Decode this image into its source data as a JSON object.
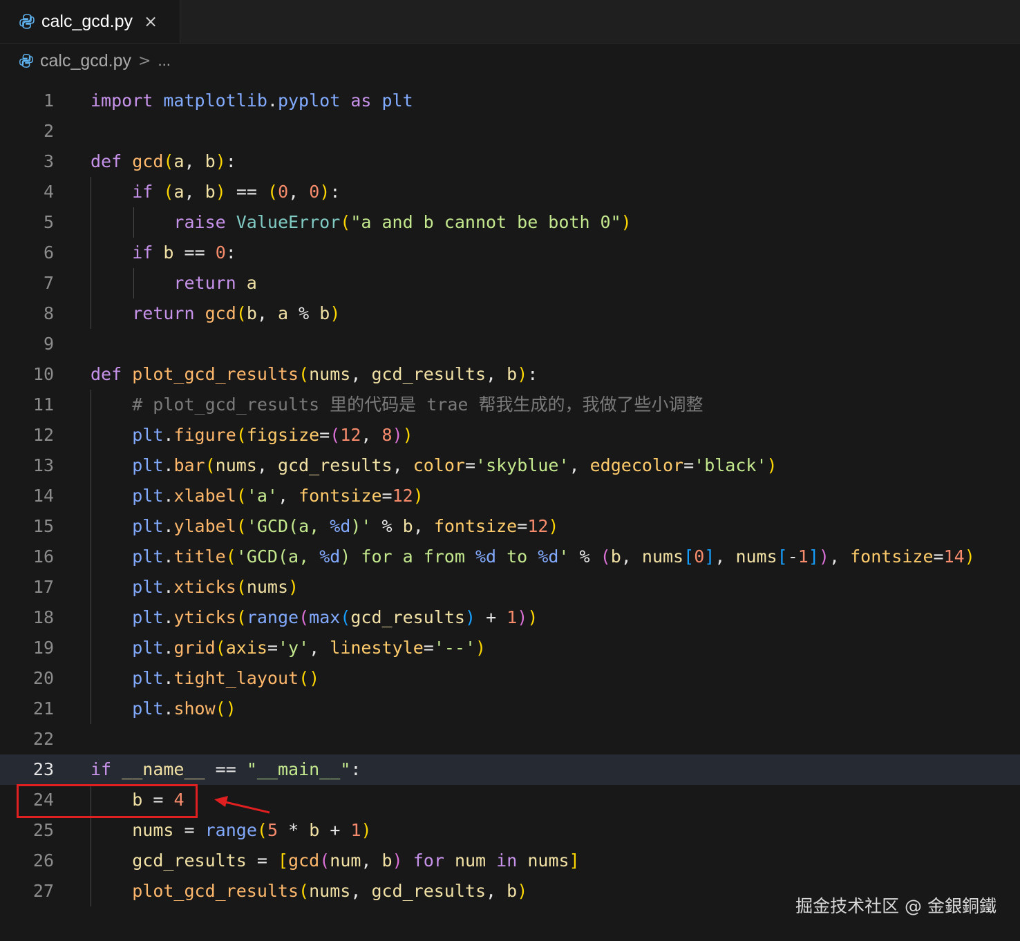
{
  "tab": {
    "label": "calc_gcd.py",
    "close": "×",
    "icon": "python-icon"
  },
  "breadcrumb": {
    "file": "calc_gcd.py",
    "separator": ">",
    "more": "..."
  },
  "editor": {
    "current_line": 23,
    "highlighted_line": 24,
    "line_numbers": [
      "1",
      "2",
      "3",
      "4",
      "5",
      "6",
      "7",
      "8",
      "9",
      "10",
      "11",
      "12",
      "13",
      "14",
      "15",
      "16",
      "17",
      "18",
      "19",
      "20",
      "21",
      "22",
      "23",
      "24",
      "25",
      "26",
      "27"
    ]
  },
  "colors": {
    "background": "#181818",
    "keyword": "#c792ea",
    "function": "#ffb86c",
    "string": "#c3e88d",
    "number": "#f78c6c",
    "comment": "#7a7a7a",
    "highlight_box": "#e02020"
  },
  "code_lines": [
    "import matplotlib.pyplot as plt",
    "",
    "def gcd(a, b):",
    "    if (a, b) == (0, 0):",
    "        raise ValueError(\"a and b cannot be both 0\")",
    "    if b == 0:",
    "        return a",
    "    return gcd(b, a % b)",
    "",
    "def plot_gcd_results(nums, gcd_results, b):",
    "    # plot_gcd_results 里的代码是 trae 帮我生成的，我做了些小调整",
    "    plt.figure(figsize=(12, 8))",
    "    plt.bar(nums, gcd_results, color='skyblue', edgecolor='black')",
    "    plt.xlabel('a', fontsize=12)",
    "    plt.ylabel('GCD(a, %d)' % b, fontsize=12)",
    "    plt.title('GCD(a, %d) for a from %d to %d' % (b, nums[0], nums[-1]), fontsize=14)",
    "    plt.xticks(nums)",
    "    plt.yticks(range(max(gcd_results) + 1))",
    "    plt.grid(axis='y', linestyle='--')",
    "    plt.tight_layout()",
    "    plt.show()",
    "",
    "if __name__ == \"__main__\":",
    "    b = 4",
    "    nums = range(5 * b + 1)",
    "    gcd_results = [gcd(num, b) for num in nums]",
    "    plot_gcd_results(nums, gcd_results, b)"
  ],
  "watermark": "掘金技术社区 @ 金銀銅鐵"
}
